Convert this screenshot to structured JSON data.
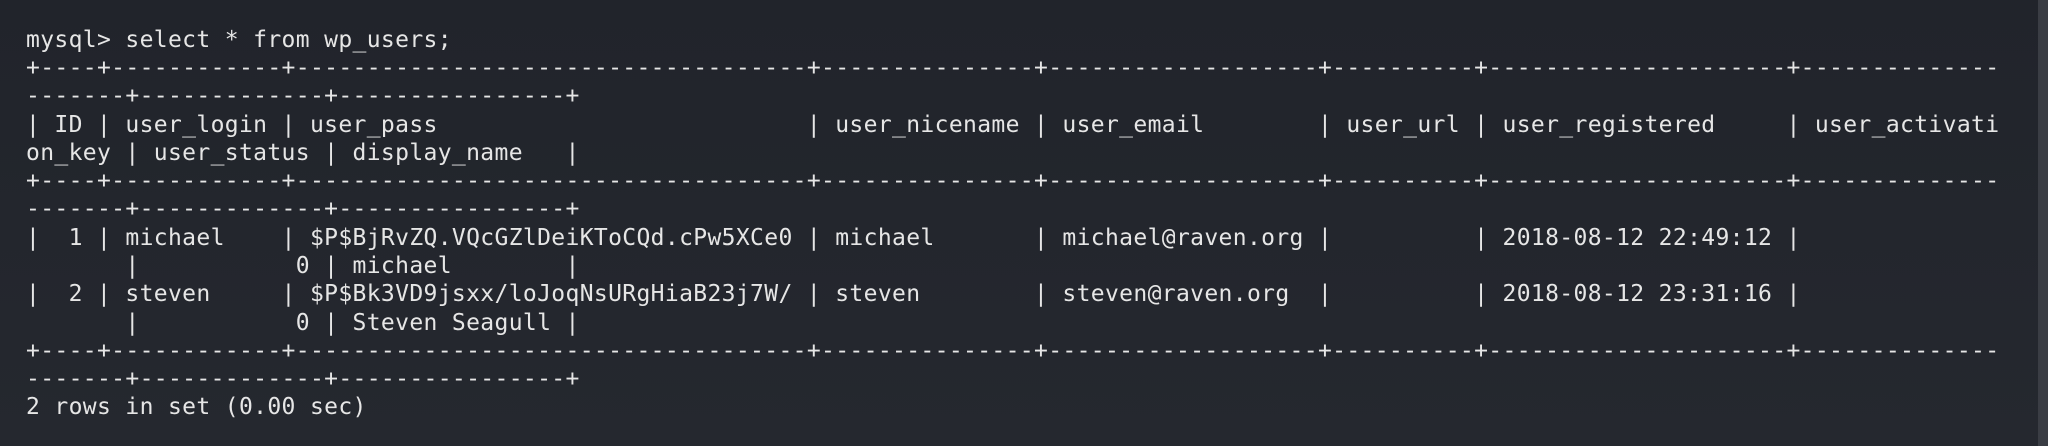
{
  "terminal": {
    "lines": [
      "mysql> select * from wp_users;",
      "+----+------------+------------------------------------+---------------+-------------------+----------+---------------------+--------------",
      "-------+-------------+----------------+",
      "| ID | user_login | user_pass                          | user_nicename | user_email        | user_url | user_registered     | user_activati",
      "on_key | user_status | display_name   |",
      "+----+------------+------------------------------------+---------------+-------------------+----------+---------------------+--------------",
      "-------+-------------+----------------+",
      "|  1 | michael    | $P$BjRvZQ.VQcGZlDeiKToCQd.cPw5XCe0 | michael       | michael@raven.org |          | 2018-08-12 22:49:12 |",
      "       |           0 | michael        |",
      "|  2 | steven     | $P$Bk3VD9jsxx/loJoqNsURgHiaB23j7W/ | steven        | steven@raven.org  |          | 2018-08-12 23:31:16 |",
      "       |           0 | Steven Seagull |",
      "+----+------------+------------------------------------+---------------+-------------------+----------+---------------------+--------------",
      "-------+-------------+----------------+",
      "2 rows in set (0.00 sec)"
    ]
  }
}
